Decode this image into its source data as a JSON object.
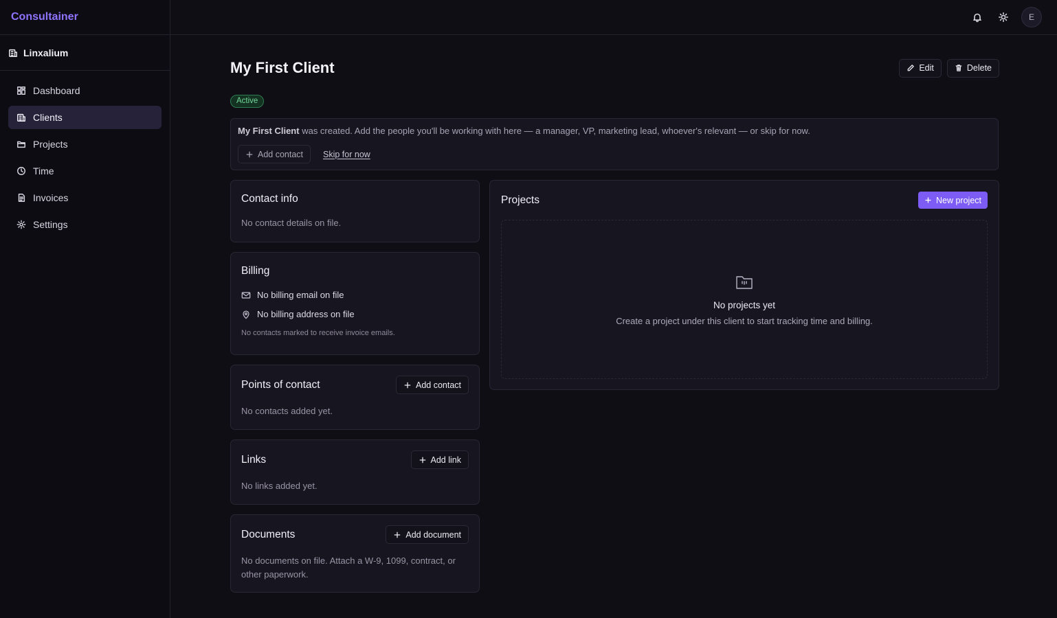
{
  "app": {
    "name": "Consultainer"
  },
  "workspace": {
    "name": "Linxalium",
    "icon": "building-icon"
  },
  "sidebar": {
    "items": [
      {
        "label": "Dashboard",
        "icon": "dashboard-icon",
        "active": false
      },
      {
        "label": "Clients",
        "icon": "clients-icon",
        "active": true
      },
      {
        "label": "Projects",
        "icon": "folder-icon",
        "active": false
      },
      {
        "label": "Time",
        "icon": "clock-icon",
        "active": false
      },
      {
        "label": "Invoices",
        "icon": "invoice-icon",
        "active": false
      },
      {
        "label": "Settings",
        "icon": "gear-icon",
        "active": false
      }
    ]
  },
  "topbar": {
    "avatar_initial": "E"
  },
  "client": {
    "name": "My First Client",
    "status": "Active",
    "edit_label": "Edit",
    "delete_label": "Delete"
  },
  "banner": {
    "client_name": "My First Client",
    "message": "was created. Add the people you'll be working with here — a manager, VP, marketing lead, whoever's relevant — or skip for now.",
    "add_contact_label": "Add contact",
    "skip_label": "Skip for now"
  },
  "contact_info": {
    "title": "Contact info",
    "empty": "No contact details on file."
  },
  "billing": {
    "title": "Billing",
    "email": "No billing email on file",
    "address": "No billing address on file",
    "note": "No contacts marked to receive invoice emails."
  },
  "points_of_contact": {
    "title": "Points of contact",
    "add_label": "Add contact",
    "empty": "No contacts added yet."
  },
  "links": {
    "title": "Links",
    "add_label": "Add link",
    "empty": "No links added yet."
  },
  "documents": {
    "title": "Documents",
    "add_label": "Add document",
    "empty": "No documents on file. Attach a W-9, 1099, contract, or other paperwork."
  },
  "projects": {
    "title": "Projects",
    "new_label": "New project",
    "empty_title": "No projects yet",
    "empty_desc": "Create a project under this client to start tracking time and billing."
  },
  "colors": {
    "accent": "#7c5cf5",
    "brand": "#8f74ff",
    "active_badge": "#73d69a",
    "background": "#0f0e14"
  }
}
